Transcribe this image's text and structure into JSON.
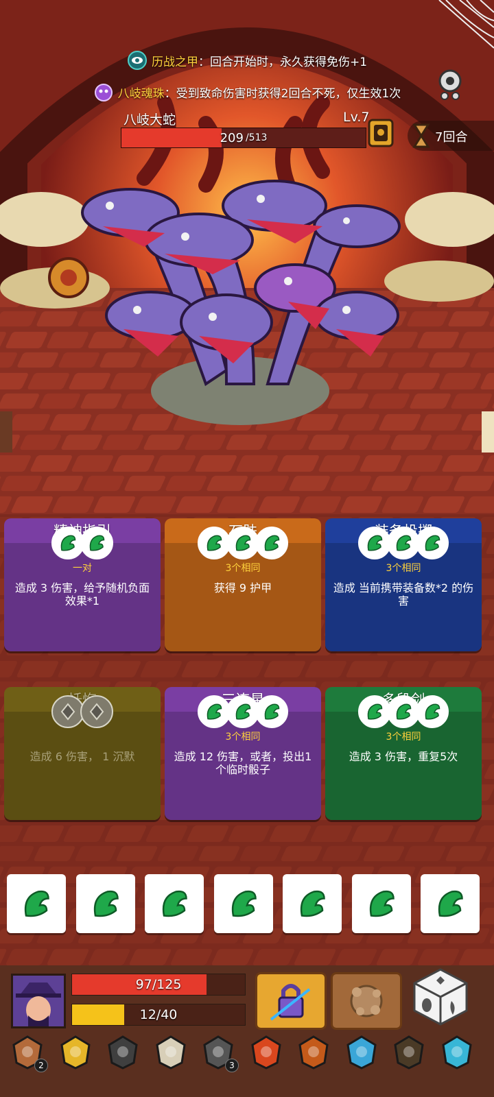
{
  "effects": [
    {
      "name": "历战之甲",
      "text": "回合开始时，永久获得免伤+1"
    },
    {
      "name": "八岐魂珠",
      "text": "受到致命伤害时获得2回合不死，仅生效1次"
    }
  ],
  "boss": {
    "name": "八岐大蛇",
    "level": "Lv.7",
    "hp_current": "209",
    "hp_max": "/513",
    "hp_fraction": 0.41
  },
  "round": {
    "label": "7回合"
  },
  "cards": [
    {
      "title": "精神指引",
      "dice": 2,
      "requirement": "一对",
      "description": "造成 3 伤害，给予随机负面效果*1",
      "color": "#7a3ea3",
      "enabled": true
    },
    {
      "title": "石肤",
      "dice": 3,
      "requirement": "3个相同",
      "description": "获得 9 护甲",
      "color": "#c96a1a",
      "enabled": true
    },
    {
      "title": "装备投掷",
      "dice": 3,
      "requirement": "3个相同",
      "description": "造成 当前携带装备数*2 的伤害",
      "color": "#1f3f9c",
      "enabled": true
    },
    {
      "title": "忏悔",
      "dice": 2,
      "requirement": "",
      "description": "造成 6 伤害， 1 沉默",
      "color": "#6f5f16",
      "enabled": false
    },
    {
      "title": "三连星",
      "dice": 3,
      "requirement": "3个相同",
      "description": "造成 12 伤害，或者，投出1个临时骰子",
      "color": "#7a3ea3",
      "enabled": true
    },
    {
      "title": "多段剑",
      "dice": 3,
      "requirement": "3个相同",
      "description": "造成 3 伤害，重复5次",
      "color": "#1e7b3c",
      "enabled": true
    }
  ],
  "dice_tray": {
    "count": 7,
    "face": "leaf-icon"
  },
  "player": {
    "hp_text": "97/125",
    "hp_fraction": 0.776,
    "energy_text": "12/40",
    "energy_fraction": 0.3
  },
  "inventory": [
    {
      "icon": "shield-round-icon",
      "badge": "2"
    },
    {
      "icon": "crown-helmet-icon",
      "badge": ""
    },
    {
      "icon": "collar-armor-icon",
      "badge": ""
    },
    {
      "icon": "scroll-icon",
      "badge": ""
    },
    {
      "icon": "mask-icon",
      "badge": "3"
    },
    {
      "icon": "horn-icon",
      "badge": ""
    },
    {
      "icon": "ring-icon",
      "badge": ""
    },
    {
      "icon": "crystal-crown-icon",
      "badge": ""
    },
    {
      "icon": "dark-wing-icon",
      "badge": ""
    },
    {
      "icon": "blue-flame-icon",
      "badge": ""
    }
  ],
  "colors": {
    "hp_red": "#e53a2c",
    "energy_yellow": "#f5c21a",
    "leaf_green": "#1fa84a",
    "highlight_yellow": "#ffd23c"
  }
}
